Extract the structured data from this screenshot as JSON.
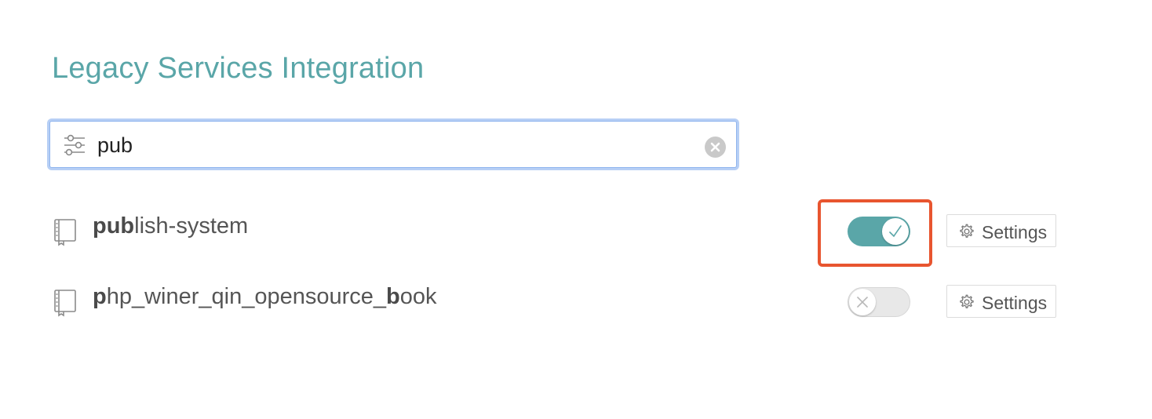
{
  "header": {
    "title": "Legacy Services Integration"
  },
  "search": {
    "value": "pub",
    "filter_icon": "sliders-icon",
    "clear_icon": "clear-circle-icon"
  },
  "repos": [
    {
      "name_bold": "pub",
      "name_rest": "lish-system",
      "enabled": true,
      "highlighted": true,
      "settings_label": "Settings"
    },
    {
      "name_parts": [
        {
          "text": "p",
          "bold": true
        },
        {
          "text": "hp_winer_qin_opensource_",
          "bold": false
        },
        {
          "text": "b",
          "bold": true
        },
        {
          "text": "ook",
          "bold": false
        }
      ],
      "enabled": false,
      "highlighted": false,
      "settings_label": "Settings"
    }
  ],
  "colors": {
    "accent": "#5aa6a8",
    "highlight": "#e8552f",
    "focus_ring": "#b7cff5"
  }
}
